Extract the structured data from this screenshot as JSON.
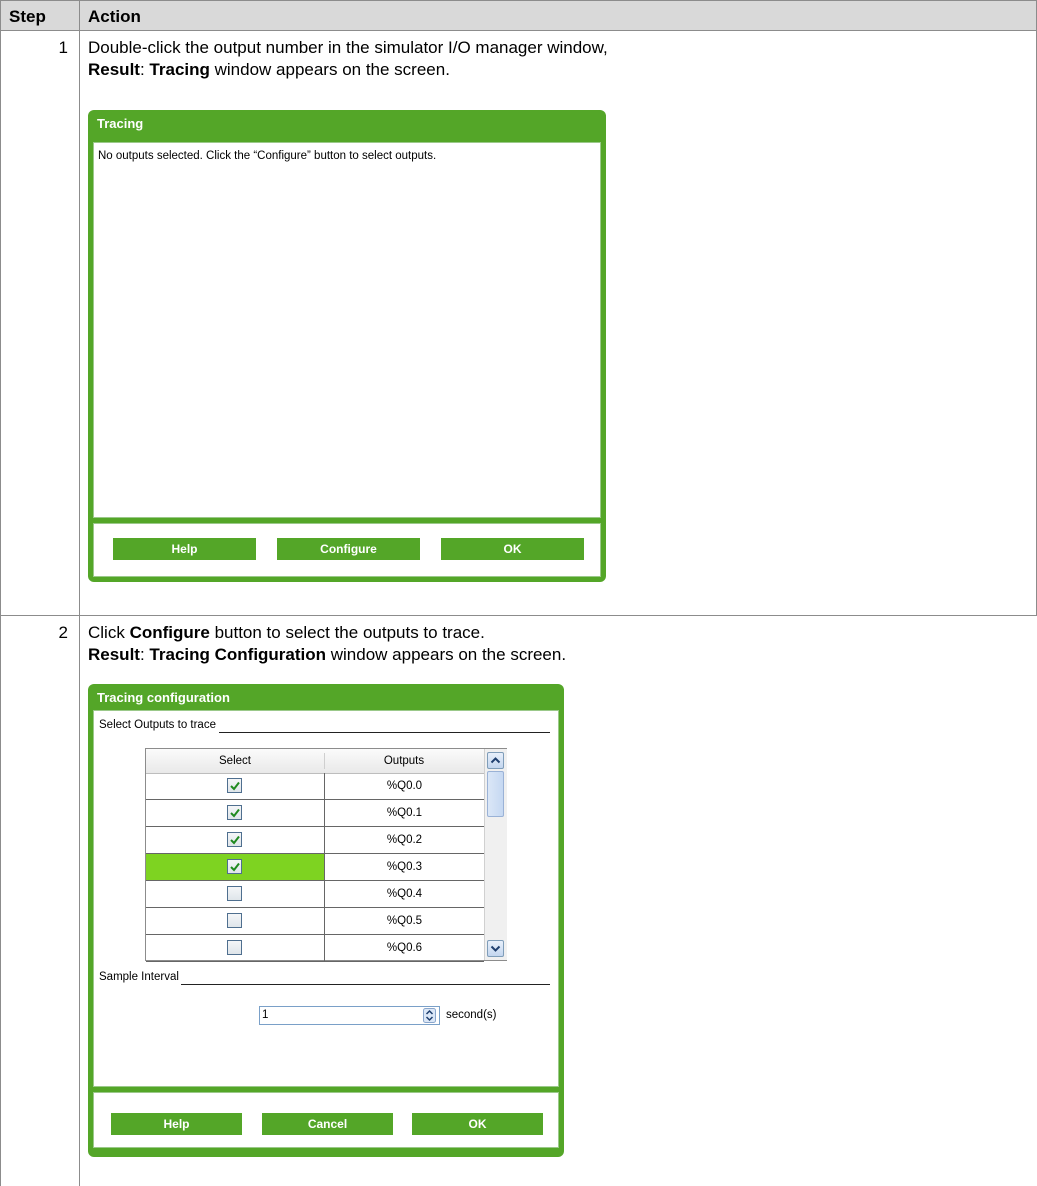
{
  "table": {
    "header_step": "Step",
    "header_action": "Action"
  },
  "steps": [
    {
      "number": "1",
      "line1": "Double-click the output number in the simulator I/O manager window,",
      "result_label": "Result",
      "result_bold": "Tracing",
      "result_rest": " window appears on the screen."
    },
    {
      "number": "2",
      "line1_pre": "Click ",
      "line1_bold": "Configure",
      "line1_post": " button to select the outputs to trace.",
      "result_label": "Result",
      "result_bold": "Tracing Configuration",
      "result_rest": " window appears on the screen."
    }
  ],
  "tracing_window": {
    "title": "Tracing",
    "message": "No outputs selected. Click the “Configure” button to select outputs.",
    "buttons": {
      "help": "Help",
      "configure": "Configure",
      "ok": "OK"
    }
  },
  "config_window": {
    "title": "Tracing configuration",
    "group_outputs": "Select Outputs to trace",
    "grid_headers": {
      "select": "Select",
      "outputs": "Outputs"
    },
    "rows": [
      {
        "output": "%Q0.0",
        "checked": true,
        "highlighted": false
      },
      {
        "output": "%Q0.1",
        "checked": true,
        "highlighted": false
      },
      {
        "output": "%Q0.2",
        "checked": true,
        "highlighted": false
      },
      {
        "output": "%Q0.3",
        "checked": true,
        "highlighted": true
      },
      {
        "output": "%Q0.4",
        "checked": false,
        "highlighted": false
      },
      {
        "output": "%Q0.5",
        "checked": false,
        "highlighted": false
      },
      {
        "output": "%Q0.6",
        "checked": false,
        "highlighted": false
      }
    ],
    "group_interval": "Sample Interval",
    "interval_value": "1",
    "interval_unit": "second(s)",
    "buttons": {
      "help": "Help",
      "cancel": "Cancel",
      "ok": "OK"
    }
  },
  "colors": {
    "window_green": "#54a628",
    "row_highlight": "#7ed321",
    "header_gray": "#d9d9d9"
  }
}
